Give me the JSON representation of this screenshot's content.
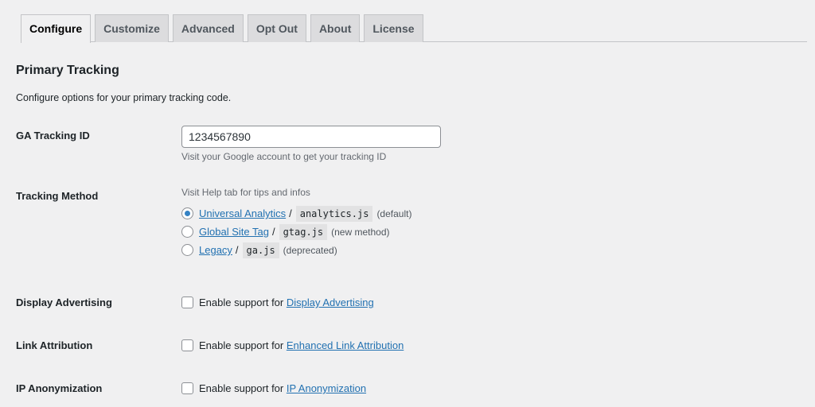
{
  "tabs": [
    {
      "label": "Configure",
      "active": true
    },
    {
      "label": "Customize"
    },
    {
      "label": "Advanced"
    },
    {
      "label": "Opt Out"
    },
    {
      "label": "About"
    },
    {
      "label": "License"
    }
  ],
  "section": {
    "title": "Primary Tracking",
    "description": "Configure options for your primary tracking code."
  },
  "tracking_id": {
    "label": "GA Tracking ID",
    "value": "1234567890",
    "hint": "Visit your Google account to get your tracking ID"
  },
  "tracking_method": {
    "label": "Tracking Method",
    "hint": "Visit Help tab for tips and infos",
    "separator": "/",
    "options": [
      {
        "link": "Universal Analytics",
        "code": "analytics.js",
        "note": "(default)",
        "selected": true
      },
      {
        "link": "Global Site Tag",
        "code": "gtag.js",
        "note": "(new method)",
        "selected": false
      },
      {
        "link": "Legacy",
        "code": "ga.js",
        "note": "(deprecated)",
        "selected": false
      }
    ]
  },
  "checkboxes": [
    {
      "label": "Display Advertising",
      "prefix": "Enable support for",
      "link": "Display Advertising",
      "checked": false
    },
    {
      "label": "Link Attribution",
      "prefix": "Enable support for",
      "link": "Enhanced Link Attribution",
      "checked": false
    },
    {
      "label": "IP Anonymization",
      "prefix": "Enable support for",
      "link": "IP Anonymization",
      "checked": false
    }
  ],
  "colors": {
    "background": "#f0f0f1",
    "link": "#2271b1",
    "radio_selected": "#3582c4"
  }
}
